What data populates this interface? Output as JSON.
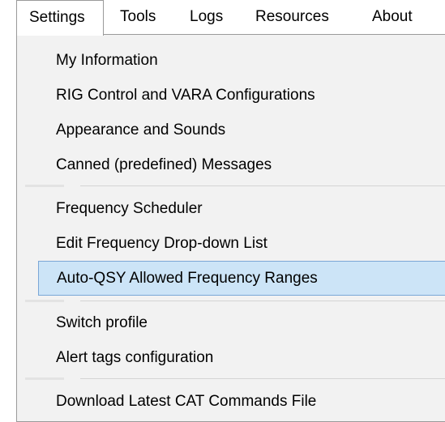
{
  "menubar": {
    "items": [
      {
        "label": "Settings",
        "active": true
      },
      {
        "label": "Tools"
      },
      {
        "label": "Logs"
      },
      {
        "label": "Resources"
      },
      {
        "label": "About"
      }
    ]
  },
  "settings_menu": {
    "items": [
      {
        "label": "My Information"
      },
      {
        "label": "RIG Control and VARA Configurations"
      },
      {
        "label": "Appearance and Sounds"
      },
      {
        "label": "Canned (predefined) Messages"
      },
      {
        "label": "Frequency Scheduler"
      },
      {
        "label": "Edit Frequency Drop-down List"
      },
      {
        "label": "Auto-QSY Allowed Frequency Ranges",
        "highlighted": true
      },
      {
        "label": "Switch profile"
      },
      {
        "label": "Alert tags configuration"
      },
      {
        "label": "Download Latest CAT Commands File"
      }
    ]
  },
  "colors": {
    "highlight_bg": "#cce4f7",
    "highlight_border": "#7aa7d6",
    "menu_bg": "#f2f2f2",
    "border": "#9a9a9a"
  }
}
